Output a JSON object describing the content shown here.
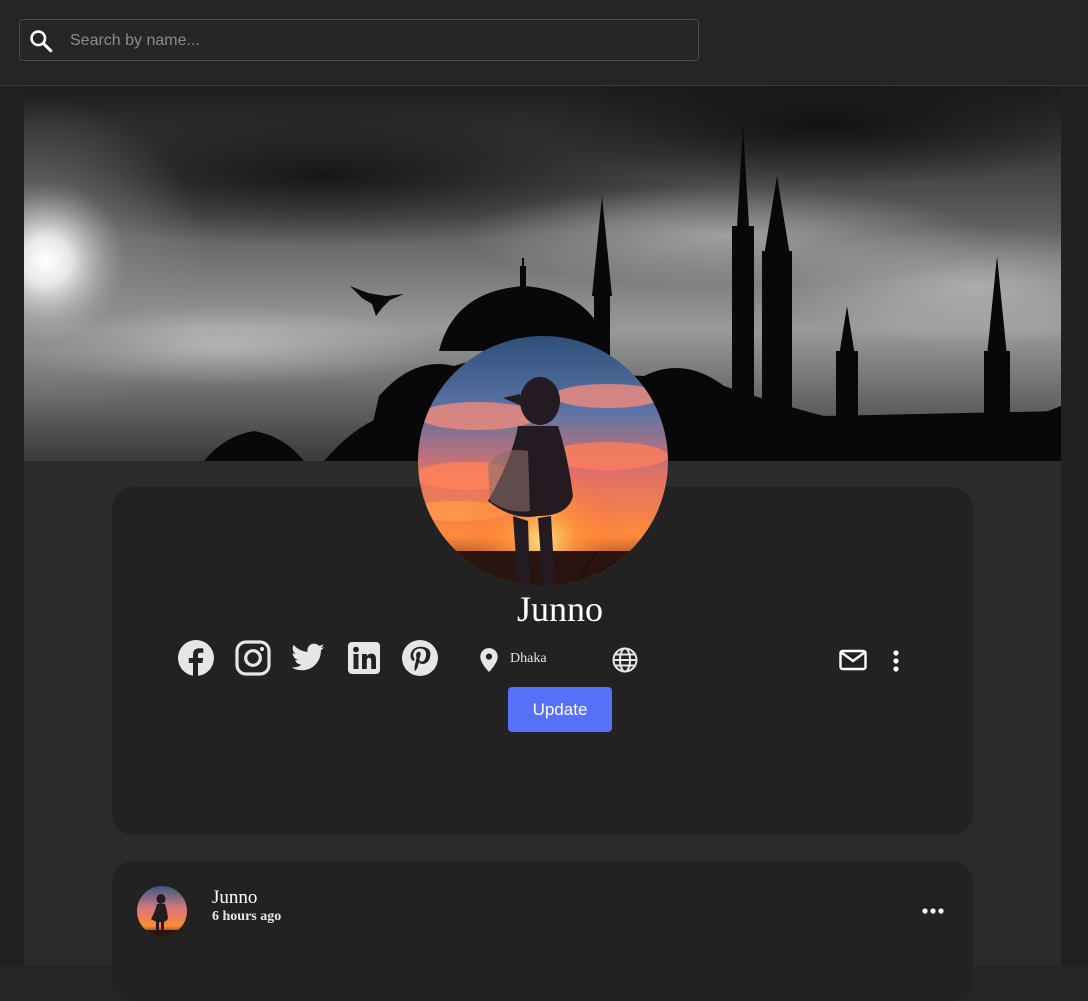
{
  "search": {
    "placeholder": "Search by name..."
  },
  "profile": {
    "name": "Junno",
    "location": "Dhaka",
    "update_label": "Update",
    "social_links": [
      "facebook-icon",
      "instagram-icon",
      "twitter-icon",
      "linkedin-icon",
      "pinterest-icon"
    ]
  },
  "post": {
    "author": "Junno",
    "time": "6 hours ago"
  },
  "colors": {
    "background": "#252525",
    "card": "#222222",
    "accent": "#5670f7"
  }
}
